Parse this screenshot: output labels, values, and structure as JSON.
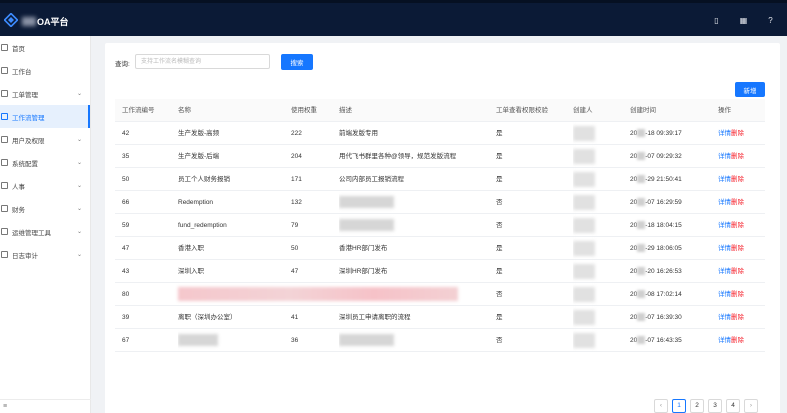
{
  "header": {
    "app_title": "OA平台",
    "icons": [
      "mobile-icon",
      "grid-icon",
      "help-icon"
    ],
    "icon_glyphs": [
      "▯",
      "▦",
      "?"
    ]
  },
  "sidebar": {
    "items": [
      {
        "label": "首页",
        "icon": "home-icon",
        "expandable": false,
        "active": false
      },
      {
        "label": "工作台",
        "icon": "workbench-icon",
        "expandable": false,
        "active": false
      },
      {
        "label": "工单管理",
        "icon": "ticket-icon",
        "expandable": true,
        "active": false
      },
      {
        "label": "工作流管理",
        "icon": "workflow-icon",
        "expandable": false,
        "active": true
      },
      {
        "label": "用户及权限",
        "icon": "user-icon",
        "expandable": true,
        "active": false
      },
      {
        "label": "系统配置",
        "icon": "settings-icon",
        "expandable": true,
        "active": false
      },
      {
        "label": "人事",
        "icon": "hr-icon",
        "expandable": true,
        "active": false
      },
      {
        "label": "财务",
        "icon": "finance-icon",
        "expandable": true,
        "active": false
      },
      {
        "label": "运维管理工具",
        "icon": "ops-icon",
        "expandable": true,
        "active": false
      },
      {
        "label": "日志审计",
        "icon": "log-icon",
        "expandable": true,
        "active": false
      }
    ]
  },
  "search": {
    "label": "查询:",
    "placeholder": "支持工作流名模糊查询",
    "value": "",
    "button_label": "搜索"
  },
  "toolbar": {
    "add_label": "新增"
  },
  "table": {
    "columns": [
      "工作流编号",
      "名称",
      "使用权重",
      "描述",
      "工单查看权限校验",
      "创建人",
      "创建时间",
      "操作"
    ],
    "rows": [
      {
        "id": "42",
        "name": "生产发版-高频",
        "weight": "222",
        "desc": "前端发版专用",
        "check": "是",
        "created": "20",
        "created_tail": "-18 09:39:17",
        "name_blur": false,
        "desc_blur": false,
        "row_blur": false
      },
      {
        "id": "35",
        "name": "生产发版-后端",
        "weight": "204",
        "desc": "用代飞书群里各种@领导，规范发版流程",
        "check": "是",
        "created": "20",
        "created_tail": "-07 09:29:32",
        "name_blur": false,
        "desc_blur": false,
        "row_blur": false
      },
      {
        "id": "50",
        "name": "员工个人财务报销",
        "weight": "171",
        "desc": "公司内部员工报销流程",
        "check": "是",
        "created": "20",
        "created_tail": "-29 21:50:41",
        "name_blur": false,
        "desc_blur": false,
        "row_blur": false
      },
      {
        "id": "66",
        "name": "Redemption",
        "weight": "132",
        "desc": "",
        "check": "否",
        "created": "20",
        "created_tail": "-07 16:29:59",
        "name_blur": false,
        "desc_blur": true,
        "row_blur": false
      },
      {
        "id": "59",
        "name": "fund_redemption",
        "weight": "79",
        "desc": "",
        "check": "否",
        "created": "20",
        "created_tail": "-18 18:04:15",
        "name_blur": false,
        "desc_blur": true,
        "row_blur": false
      },
      {
        "id": "47",
        "name": "香港入职",
        "weight": "50",
        "desc": "香港HR部门发布",
        "check": "是",
        "created": "20",
        "created_tail": "-29 18:06:05",
        "name_blur": false,
        "desc_blur": false,
        "row_blur": false
      },
      {
        "id": "43",
        "name": "深圳入职",
        "weight": "47",
        "desc": "深圳HR部门发布",
        "check": "是",
        "created": "20",
        "created_tail": "-20 16:26:53",
        "name_blur": false,
        "desc_blur": false,
        "row_blur": false
      },
      {
        "id": "80",
        "name": "",
        "weight": "",
        "desc": "",
        "check": "否",
        "created": "20",
        "created_tail": "-08 17:02:14",
        "name_blur": false,
        "desc_blur": false,
        "row_blur": true
      },
      {
        "id": "39",
        "name": "离职（深圳办公室）",
        "weight": "41",
        "desc": "深圳员工申请离职的流程",
        "check": "是",
        "created": "20",
        "created_tail": "-07 16:39:30",
        "name_blur": false,
        "desc_blur": false,
        "row_blur": false
      },
      {
        "id": "67",
        "name": "",
        "weight": "36",
        "desc": "",
        "check": "否",
        "created": "20",
        "created_tail": "-07 16:43:35",
        "name_blur": true,
        "desc_blur": true,
        "row_blur": false
      }
    ],
    "actions": {
      "detail": "详情",
      "delete": "删除"
    }
  },
  "pagination": {
    "prev": "‹",
    "pages": [
      "1",
      "2",
      "3",
      "4"
    ],
    "next": "›",
    "current": "1"
  },
  "colors": {
    "primary": "#1677ff",
    "danger": "#f5222d",
    "header_bg": "#0b1a36"
  }
}
